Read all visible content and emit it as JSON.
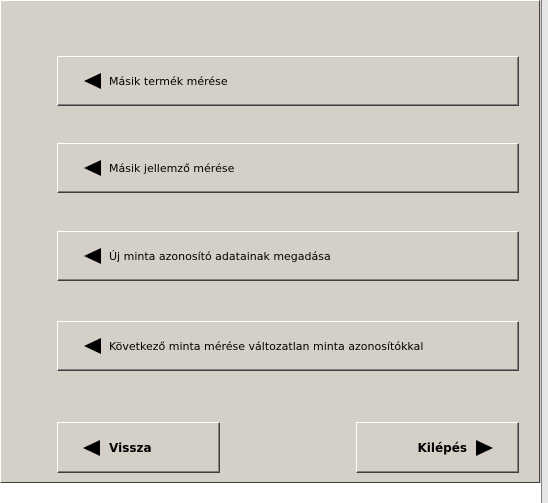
{
  "menu": {
    "items": [
      {
        "label": "Másik termék mérése",
        "icon": "arrow-left-icon"
      },
      {
        "label": "Másik jellemző mérése",
        "icon": "arrow-left-icon"
      },
      {
        "label": "Új minta azonosító adatainak megadása",
        "icon": "arrow-left-icon"
      },
      {
        "label": "Következő minta mérése változatlan minta azonosítókkal",
        "icon": "arrow-left-icon"
      }
    ]
  },
  "footer": {
    "back_label": "Vissza",
    "back_icon": "arrow-left-icon",
    "exit_label": "Kilépés",
    "exit_icon": "arrow-right-icon"
  },
  "colors": {
    "face": "#d4d0c8",
    "highlight": "#ffffff",
    "shadow": "#808080",
    "dark_shadow": "#404040",
    "text": "#000000"
  }
}
